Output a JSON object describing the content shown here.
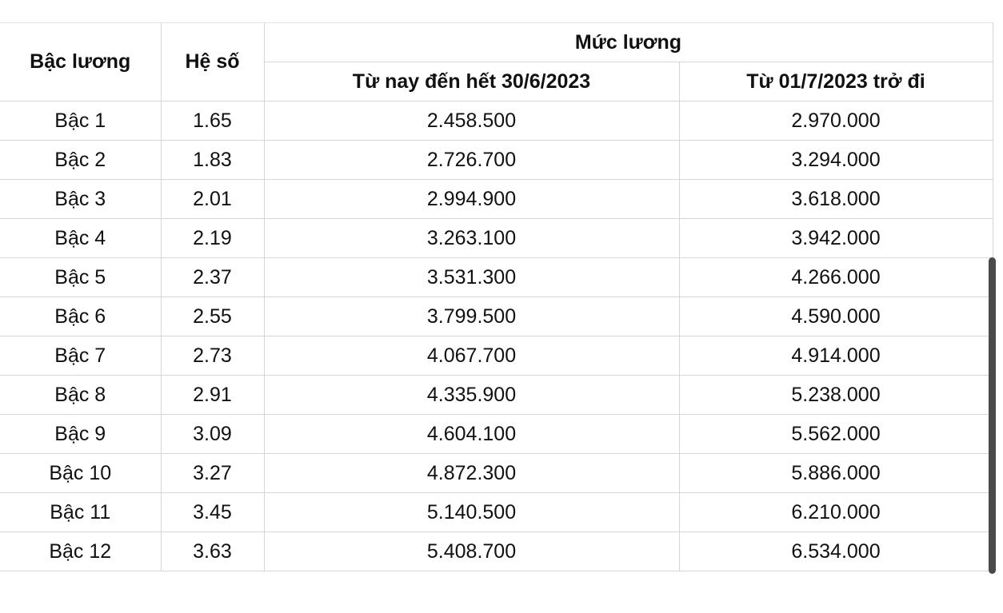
{
  "table": {
    "headers": {
      "level": "Bậc lương",
      "coefficient": "Hệ số",
      "salary_group": "Mức lương",
      "salary_current": "Từ nay đến hết 30/6/2023",
      "salary_new": "Từ 01/7/2023 trở đi"
    },
    "rows": [
      {
        "level": "Bậc 1",
        "coefficient": "1.65",
        "salary_current": "2.458.500",
        "salary_new": "2.970.000"
      },
      {
        "level": "Bậc 2",
        "coefficient": "1.83",
        "salary_current": "2.726.700",
        "salary_new": "3.294.000"
      },
      {
        "level": "Bậc 3",
        "coefficient": "2.01",
        "salary_current": "2.994.900",
        "salary_new": "3.618.000"
      },
      {
        "level": "Bậc 4",
        "coefficient": "2.19",
        "salary_current": "3.263.100",
        "salary_new": "3.942.000"
      },
      {
        "level": "Bậc 5",
        "coefficient": "2.37",
        "salary_current": "3.531.300",
        "salary_new": "4.266.000"
      },
      {
        "level": "Bậc 6",
        "coefficient": "2.55",
        "salary_current": "3.799.500",
        "salary_new": "4.590.000"
      },
      {
        "level": "Bậc 7",
        "coefficient": "2.73",
        "salary_current": "4.067.700",
        "salary_new": "4.914.000"
      },
      {
        "level": "Bậc 8",
        "coefficient": "2.91",
        "salary_current": "4.335.900",
        "salary_new": "5.238.000"
      },
      {
        "level": "Bậc 9",
        "coefficient": "3.09",
        "salary_current": "4.604.100",
        "salary_new": "5.562.000"
      },
      {
        "level": "Bậc 10",
        "coefficient": "3.27",
        "salary_current": "4.872.300",
        "salary_new": "5.886.000"
      },
      {
        "level": "Bậc 11",
        "coefficient": "3.45",
        "salary_current": "5.140.500",
        "salary_new": "6.210.000"
      },
      {
        "level": "Bậc 12",
        "coefficient": "3.63",
        "salary_current": "5.408.700",
        "salary_new": "6.534.000"
      }
    ]
  },
  "colors": {
    "grid_line": "#d6d6d6",
    "text": "#111111",
    "scrollbar": "#4a4a4a"
  }
}
